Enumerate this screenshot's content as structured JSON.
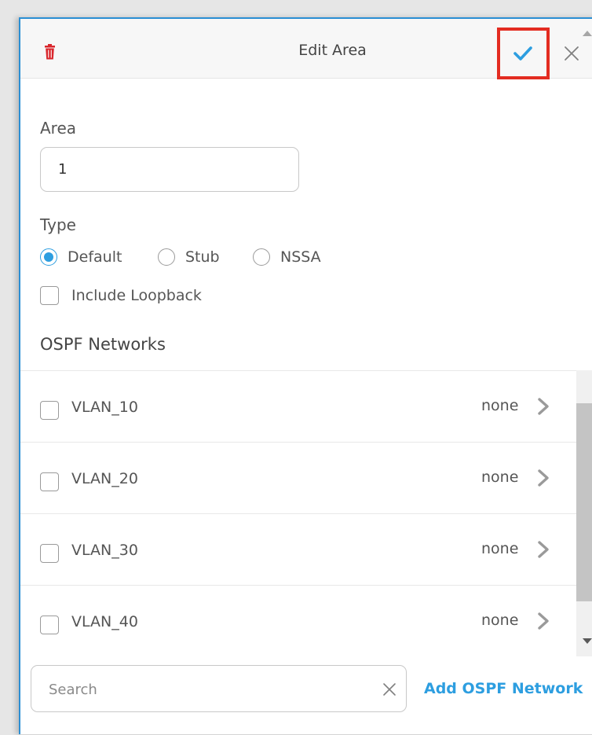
{
  "header": {
    "title": "Edit Area",
    "delete_icon": "trash-icon",
    "confirm_icon": "checkmark-icon",
    "close_icon": "close-icon",
    "accent_color": "#2d9ee0",
    "delete_color": "#d9262c",
    "highlight_color": "#e32c21"
  },
  "area": {
    "label": "Area",
    "value": "1"
  },
  "type": {
    "label": "Type",
    "options": [
      {
        "label": "Default",
        "selected": true
      },
      {
        "label": "Stub",
        "selected": false
      },
      {
        "label": "NSSA",
        "selected": false
      }
    ]
  },
  "include_loopback": {
    "label": "Include Loopback",
    "checked": false
  },
  "ospf": {
    "heading": "OSPF Networks",
    "networks": [
      {
        "name": "VLAN_10",
        "value": "none",
        "checked": false
      },
      {
        "name": "VLAN_20",
        "value": "none",
        "checked": false
      },
      {
        "name": "VLAN_30",
        "value": "none",
        "checked": false
      },
      {
        "name": "VLAN_40",
        "value": "none",
        "checked": false
      }
    ]
  },
  "footer": {
    "search_placeholder": "Search",
    "add_label": "Add OSPF Network"
  }
}
